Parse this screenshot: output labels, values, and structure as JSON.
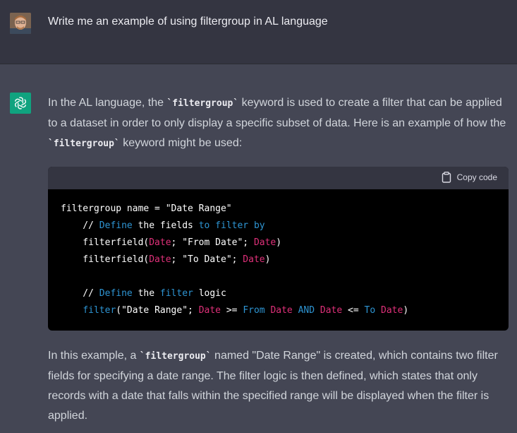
{
  "user": {
    "message": "Write me an example of using filtergroup in AL language"
  },
  "assistant": {
    "p1": {
      "t1": "In the AL language, the ",
      "k1": "`filtergroup`",
      "t2": " keyword is used to create a filter that can be applied to a dataset in order to only display a specific subset of data. Here is an example of how the ",
      "k2": "`filtergroup`",
      "t3": " keyword might be used:"
    },
    "code": {
      "copy_label": "Copy code",
      "lines": {
        "l1": "filtergroup name = \"Date Range\"",
        "l2": {
          "a": "    // ",
          "b": "Define",
          "c": " the fields ",
          "d": "to",
          "e": " ",
          "f": "filter",
          "g": " ",
          "h": "by"
        },
        "l3": {
          "a": "    filterfield(",
          "b": "Date",
          "c": "; \"From Date\"; ",
          "d": "Date",
          "e": ")"
        },
        "l4": {
          "a": "    filterfield(",
          "b": "Date",
          "c": "; \"To Date\"; ",
          "d": "Date",
          "e": ")"
        },
        "l6": {
          "a": "    // ",
          "b": "Define",
          "c": " the ",
          "d": "filter",
          "e": " logic"
        },
        "l7": {
          "a": "    ",
          "b": "filter",
          "c": "(\"Date Range\"; ",
          "d": "Date",
          "e": " >= ",
          "f": "From",
          "g": " ",
          "h": "Date",
          "i": " ",
          "j": "AND",
          "k": " ",
          "l": "Date",
          "m": " <= ",
          "n": "To",
          "o": " ",
          "p": "Date",
          "q": ")"
        }
      }
    },
    "p2": {
      "t1": "In this example, a ",
      "k1": "`filtergroup`",
      "t2": " named \"Date Range\" is created, which contains two filter fields for specifying a date range. The filter logic is then defined, which states that only records with a date that falls within the specified range will be displayed when the filter is applied."
    }
  },
  "colors": {
    "user_bg": "#343541",
    "assistant_bg": "#444654",
    "brand": "#10a37f",
    "code_bg": "#000000",
    "code_blue": "#2e95d3",
    "code_red": "#df3079"
  }
}
